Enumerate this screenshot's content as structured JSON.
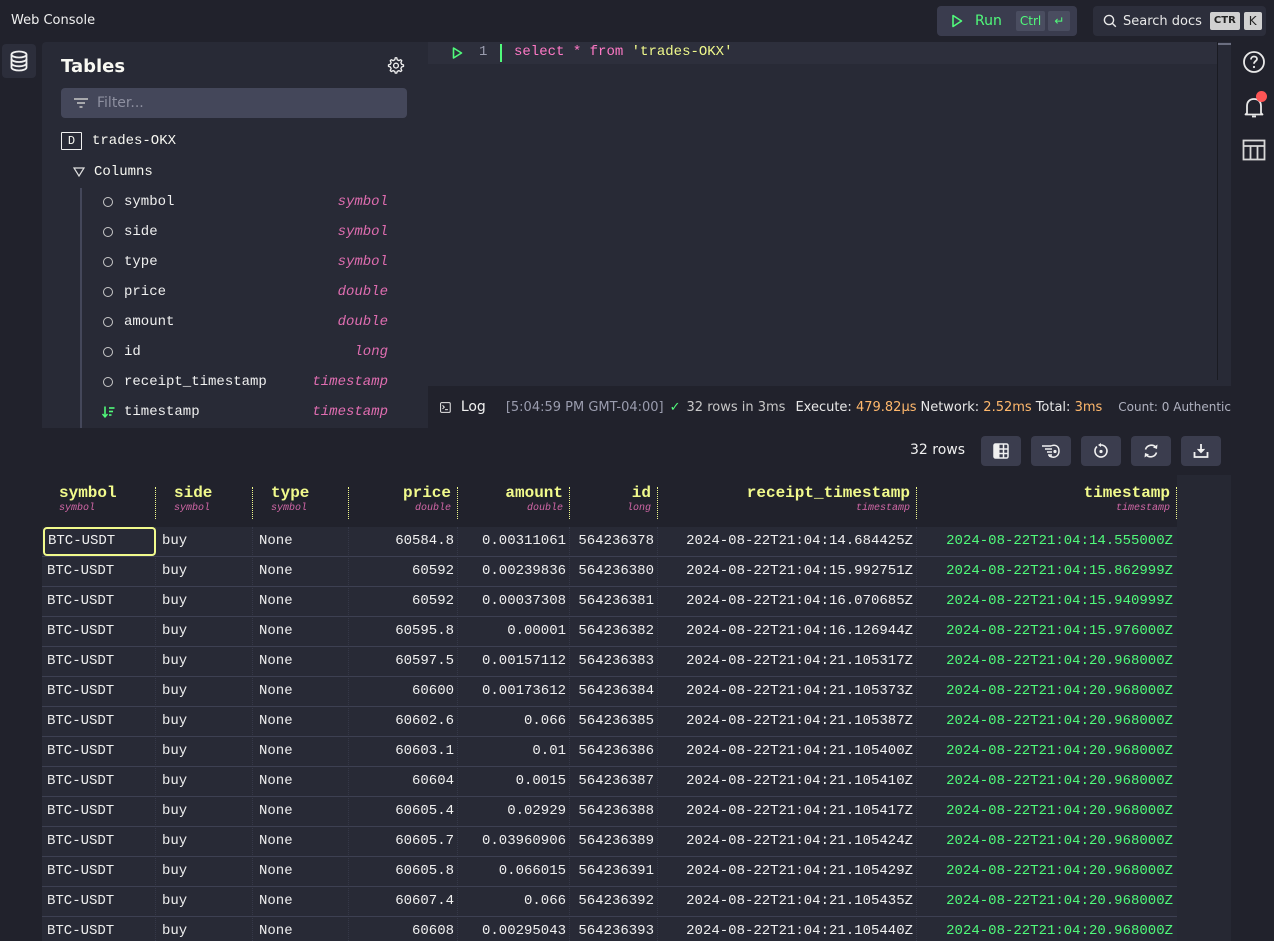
{
  "app": {
    "title": "Web Console"
  },
  "toolbar": {
    "run_label": "Run",
    "run_shortcut_mod": "Ctrl",
    "run_shortcut_key": "↵",
    "search_label": "Search docs",
    "search_shortcut_mod": "CTR",
    "search_shortcut_key": "K"
  },
  "tables_panel": {
    "title": "Tables",
    "filter_placeholder": "Filter...",
    "table_badge": "D",
    "table_name": "trades-OKX",
    "columns_label": "Columns",
    "columns": [
      {
        "name": "symbol",
        "type": "symbol",
        "designated_timestamp": false
      },
      {
        "name": "side",
        "type": "symbol",
        "designated_timestamp": false
      },
      {
        "name": "type",
        "type": "symbol",
        "designated_timestamp": false
      },
      {
        "name": "price",
        "type": "double",
        "designated_timestamp": false
      },
      {
        "name": "amount",
        "type": "double",
        "designated_timestamp": false
      },
      {
        "name": "id",
        "type": "long",
        "designated_timestamp": false
      },
      {
        "name": "receipt_timestamp",
        "type": "timestamp",
        "designated_timestamp": false
      },
      {
        "name": "timestamp",
        "type": "timestamp",
        "designated_timestamp": true
      }
    ]
  },
  "editor": {
    "line_number": "1",
    "query_keyword1": "select",
    "query_star": "*",
    "query_keyword2": "from",
    "query_table": "'trades-OKX'"
  },
  "log": {
    "label": "Log",
    "timestamp": "[5:04:59 PM GMT-04:00]",
    "check": "✓",
    "rows_msg": "32 rows in 3ms",
    "execute_label": "Execute:",
    "execute_value": "479.82μs",
    "network_label": "Network:",
    "network_value": "2.52ms",
    "total_label": "Total:",
    "total_value": "3ms",
    "count_text": "Count: 0 Authentic"
  },
  "results": {
    "row_count_label": "32 rows",
    "toolbar_buttons": [
      "freeze-columns",
      "move-columns",
      "reset-layout",
      "refresh",
      "download"
    ],
    "columns": [
      {
        "name": "symbol",
        "type": "symbol"
      },
      {
        "name": "side",
        "type": "symbol"
      },
      {
        "name": "type",
        "type": "symbol"
      },
      {
        "name": "price",
        "type": "double"
      },
      {
        "name": "amount",
        "type": "double"
      },
      {
        "name": "id",
        "type": "long"
      },
      {
        "name": "receipt_timestamp",
        "type": "timestamp"
      },
      {
        "name": "timestamp",
        "type": "timestamp"
      }
    ],
    "rows": [
      [
        "BTC-USDT",
        "buy",
        "None",
        "60584.8",
        "0.00311061",
        "564236378",
        "2024-08-22T21:04:14.684425Z",
        "2024-08-22T21:04:14.555000Z"
      ],
      [
        "BTC-USDT",
        "buy",
        "None",
        "60592",
        "0.00239836",
        "564236380",
        "2024-08-22T21:04:15.992751Z",
        "2024-08-22T21:04:15.862999Z"
      ],
      [
        "BTC-USDT",
        "buy",
        "None",
        "60592",
        "0.00037308",
        "564236381",
        "2024-08-22T21:04:16.070685Z",
        "2024-08-22T21:04:15.940999Z"
      ],
      [
        "BTC-USDT",
        "buy",
        "None",
        "60595.8",
        "0.00001",
        "564236382",
        "2024-08-22T21:04:16.126944Z",
        "2024-08-22T21:04:15.976000Z"
      ],
      [
        "BTC-USDT",
        "buy",
        "None",
        "60597.5",
        "0.00157112",
        "564236383",
        "2024-08-22T21:04:21.105317Z",
        "2024-08-22T21:04:20.968000Z"
      ],
      [
        "BTC-USDT",
        "buy",
        "None",
        "60600",
        "0.00173612",
        "564236384",
        "2024-08-22T21:04:21.105373Z",
        "2024-08-22T21:04:20.968000Z"
      ],
      [
        "BTC-USDT",
        "buy",
        "None",
        "60602.6",
        "0.066",
        "564236385",
        "2024-08-22T21:04:21.105387Z",
        "2024-08-22T21:04:20.968000Z"
      ],
      [
        "BTC-USDT",
        "buy",
        "None",
        "60603.1",
        "0.01",
        "564236386",
        "2024-08-22T21:04:21.105400Z",
        "2024-08-22T21:04:20.968000Z"
      ],
      [
        "BTC-USDT",
        "buy",
        "None",
        "60604",
        "0.0015",
        "564236387",
        "2024-08-22T21:04:21.105410Z",
        "2024-08-22T21:04:20.968000Z"
      ],
      [
        "BTC-USDT",
        "buy",
        "None",
        "60605.4",
        "0.02929",
        "564236388",
        "2024-08-22T21:04:21.105417Z",
        "2024-08-22T21:04:20.968000Z"
      ],
      [
        "BTC-USDT",
        "buy",
        "None",
        "60605.7",
        "0.03960906",
        "564236389",
        "2024-08-22T21:04:21.105424Z",
        "2024-08-22T21:04:20.968000Z"
      ],
      [
        "BTC-USDT",
        "buy",
        "None",
        "60605.8",
        "0.066015",
        "564236391",
        "2024-08-22T21:04:21.105429Z",
        "2024-08-22T21:04:20.968000Z"
      ],
      [
        "BTC-USDT",
        "buy",
        "None",
        "60607.4",
        "0.066",
        "564236392",
        "2024-08-22T21:04:21.105435Z",
        "2024-08-22T21:04:20.968000Z"
      ],
      [
        "BTC-USDT",
        "buy",
        "None",
        "60608",
        "0.00295043",
        "564236393",
        "2024-08-22T21:04:21.105440Z",
        "2024-08-22T21:04:20.968000Z"
      ]
    ]
  },
  "colors": {
    "accent_green": "#50fa7b",
    "header_yellow": "#f1fa8c",
    "type_pink": "#ff79c6",
    "timing_orange": "#ffb86c",
    "notification_red": "#ff5555"
  }
}
